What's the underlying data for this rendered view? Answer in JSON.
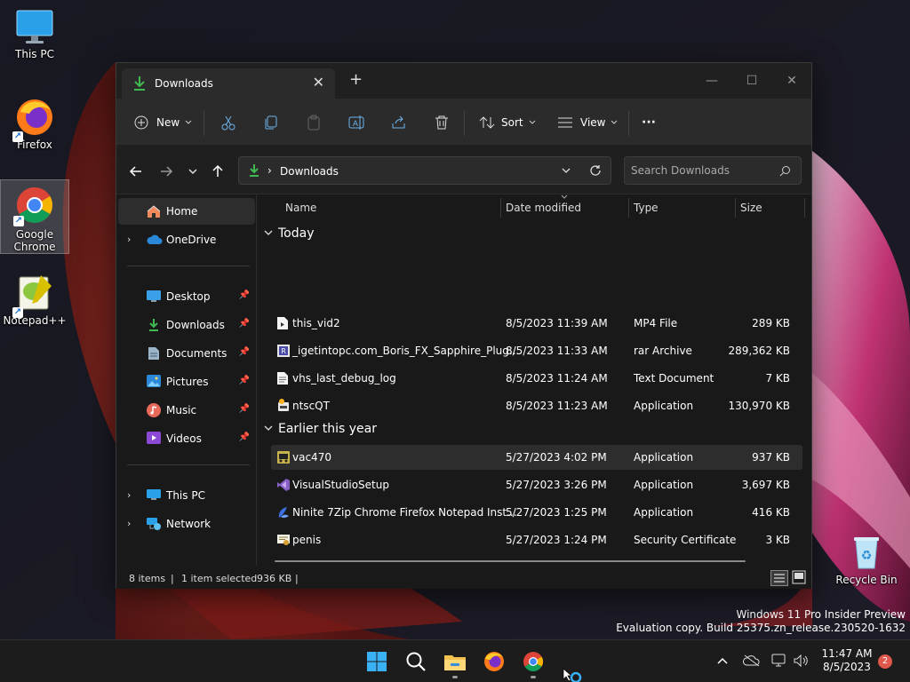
{
  "desktop": {
    "icons": [
      {
        "label": "This PC"
      },
      {
        "label": "Firefox"
      },
      {
        "label": "Google Chrome"
      },
      {
        "label": "Notepad++"
      },
      {
        "label": "Recycle Bin"
      }
    ]
  },
  "window": {
    "tab_title": "Downloads",
    "toolbar": {
      "new_label": "New",
      "sort_label": "Sort",
      "view_label": "View",
      "more_label": "···"
    },
    "address": {
      "path": "Downloads",
      "search_placeholder": "Search Downloads"
    },
    "nav": {
      "home": "Home",
      "onedrive": "OneDrive",
      "desktop": "Desktop",
      "downloads": "Downloads",
      "documents": "Documents",
      "pictures": "Pictures",
      "music": "Music",
      "videos": "Videos",
      "thispc": "This PC",
      "network": "Network"
    },
    "columns": {
      "name": "Name",
      "date": "Date modified",
      "type": "Type",
      "size": "Size"
    },
    "groups": {
      "today": "Today",
      "earlier": "Earlier this year"
    },
    "files": [
      {
        "name": "this_vid2",
        "date": "8/5/2023 11:39 AM",
        "type": "MP4 File",
        "size": "289 KB"
      },
      {
        "name": "_igetintopc.com_Boris_FX_Sapphire_Plug...",
        "date": "8/5/2023 11:33 AM",
        "type": "rar Archive",
        "size": "289,362 KB"
      },
      {
        "name": "vhs_last_debug_log",
        "date": "8/5/2023 11:24 AM",
        "type": "Text Document",
        "size": "7 KB"
      },
      {
        "name": "ntscQT",
        "date": "8/5/2023 11:23 AM",
        "type": "Application",
        "size": "130,970 KB"
      },
      {
        "name": "vac470",
        "date": "5/27/2023 4:02 PM",
        "type": "Application",
        "size": "937 KB"
      },
      {
        "name": "VisualStudioSetup",
        "date": "5/27/2023 3:26 PM",
        "type": "Application",
        "size": "3,697 KB"
      },
      {
        "name": "Ninite 7Zip Chrome Firefox Notepad Inst...",
        "date": "5/27/2023 1:25 PM",
        "type": "Application",
        "size": "416 KB"
      },
      {
        "name": "penis",
        "date": "5/27/2023 1:24 PM",
        "type": "Security Certificate",
        "size": "3 KB"
      }
    ],
    "status": {
      "items": "8 items",
      "selected": "1 item selected",
      "size": "936 KB"
    }
  },
  "watermark": {
    "line1": "Windows 11 Pro Insider Preview",
    "line2": "Evaluation copy. Build 25375.zn_release.230520-1632"
  },
  "taskbar": {
    "time": "11:47 AM",
    "date": "8/5/2023",
    "notifications": "2"
  },
  "colors": {
    "accent_green": "#3fb950",
    "folder_yellow": "#f2c14e",
    "taskbar_bg": "#1c1c1c"
  }
}
